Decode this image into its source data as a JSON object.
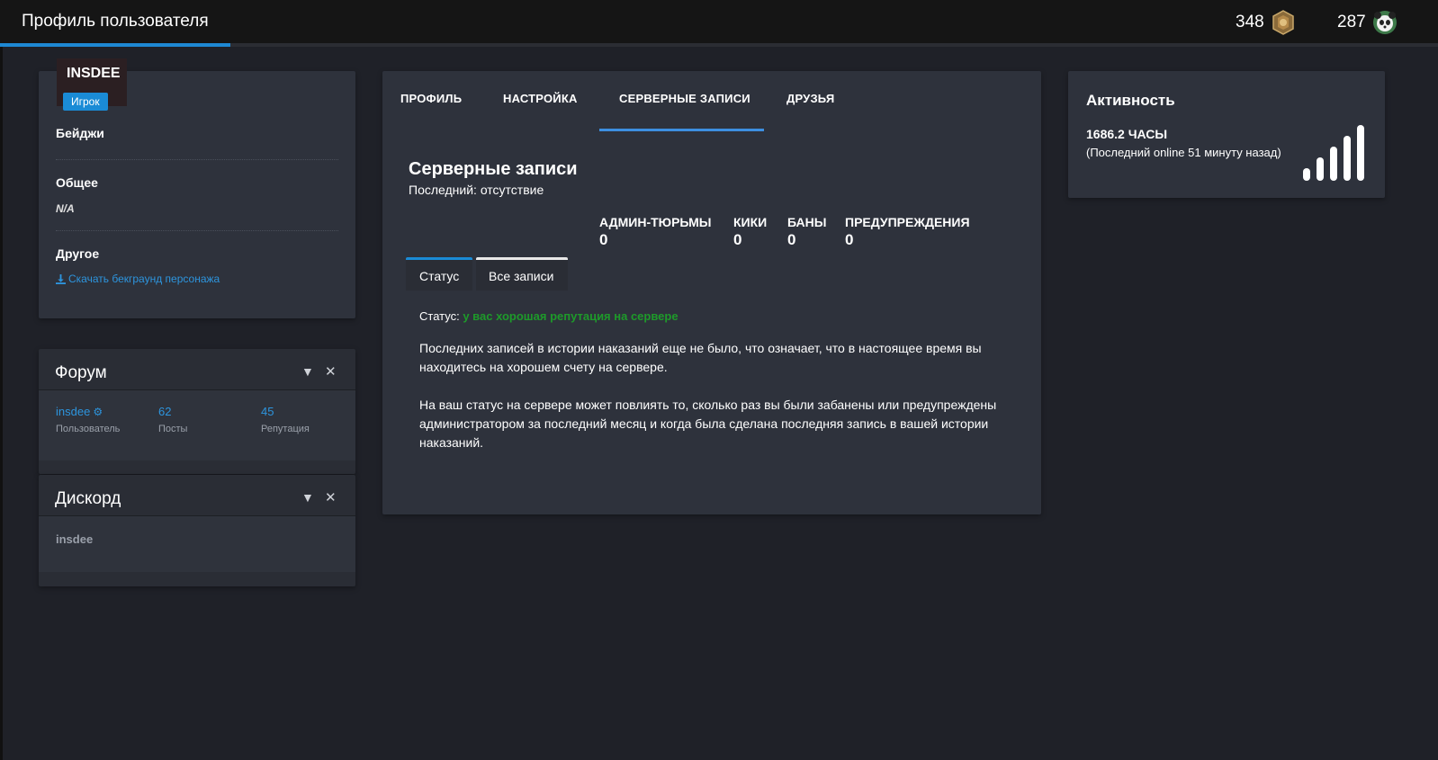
{
  "header": {
    "title": "Профиль пользователя",
    "stat1": {
      "value": "348",
      "icon": "medal-icon"
    },
    "stat2": {
      "value": "287",
      "icon": "panda-icon"
    },
    "progress_percent": 16
  },
  "profile": {
    "username": "INSDEE",
    "role": "Игрок",
    "badges_label": "Бейджи",
    "general_label": "Общее",
    "general_value": "N/A",
    "other_label": "Другое",
    "download_link": "Скачать бекграунд персонажа"
  },
  "forum": {
    "title": "Форум",
    "user_value": "insdee",
    "user_caption": "Пользователь",
    "posts_value": "62",
    "posts_caption": "Посты",
    "rep_value": "45",
    "rep_caption": "Репутация"
  },
  "discord": {
    "title": "Дискорд",
    "name": "insdee"
  },
  "main": {
    "tabs": [
      "ПРОФИЛЬ",
      "НАСТРОЙКА",
      "СЕРВЕРНЫЕ ЗАПИСИ",
      "ДРУЗЬЯ"
    ],
    "active_tab": "СЕРВЕРНЫЕ ЗАПИСИ",
    "title": "Серверные записи",
    "subtitle": "Последний: отсутствие",
    "counters": [
      {
        "label": "АДМИН-ТЮРЬМЫ",
        "value": "0"
      },
      {
        "label": "КИКИ",
        "value": "0"
      },
      {
        "label": "БАНЫ",
        "value": "0"
      },
      {
        "label": "ПРЕДУПРЕЖДЕНИЯ",
        "value": "0"
      }
    ],
    "subtabs": [
      "Статус",
      "Все записи"
    ],
    "status_label": "Статус:",
    "status_value": "у вас хорошая репутация на сервере",
    "para1": "Последних записей в истории наказаний еще не было, что означает, что в настоящее время вы находитесь на хорошем счету на сервере.",
    "para2": "На ваш статус на сервере может повлиять то, сколько раз вы были забанены или предупреждены администратором за последний месяц и когда была сделана последняя запись в вашей истории наказаний."
  },
  "activity": {
    "title": "Активность",
    "hours": "1686.2 ЧАСЫ",
    "last_online": "(Последний online 51 минуту назад)",
    "signal_bars": 5
  },
  "colors": {
    "accent": "#1a8bd6",
    "good": "#1e9a2a",
    "card": "#2e323c",
    "background": "#1f2128"
  }
}
